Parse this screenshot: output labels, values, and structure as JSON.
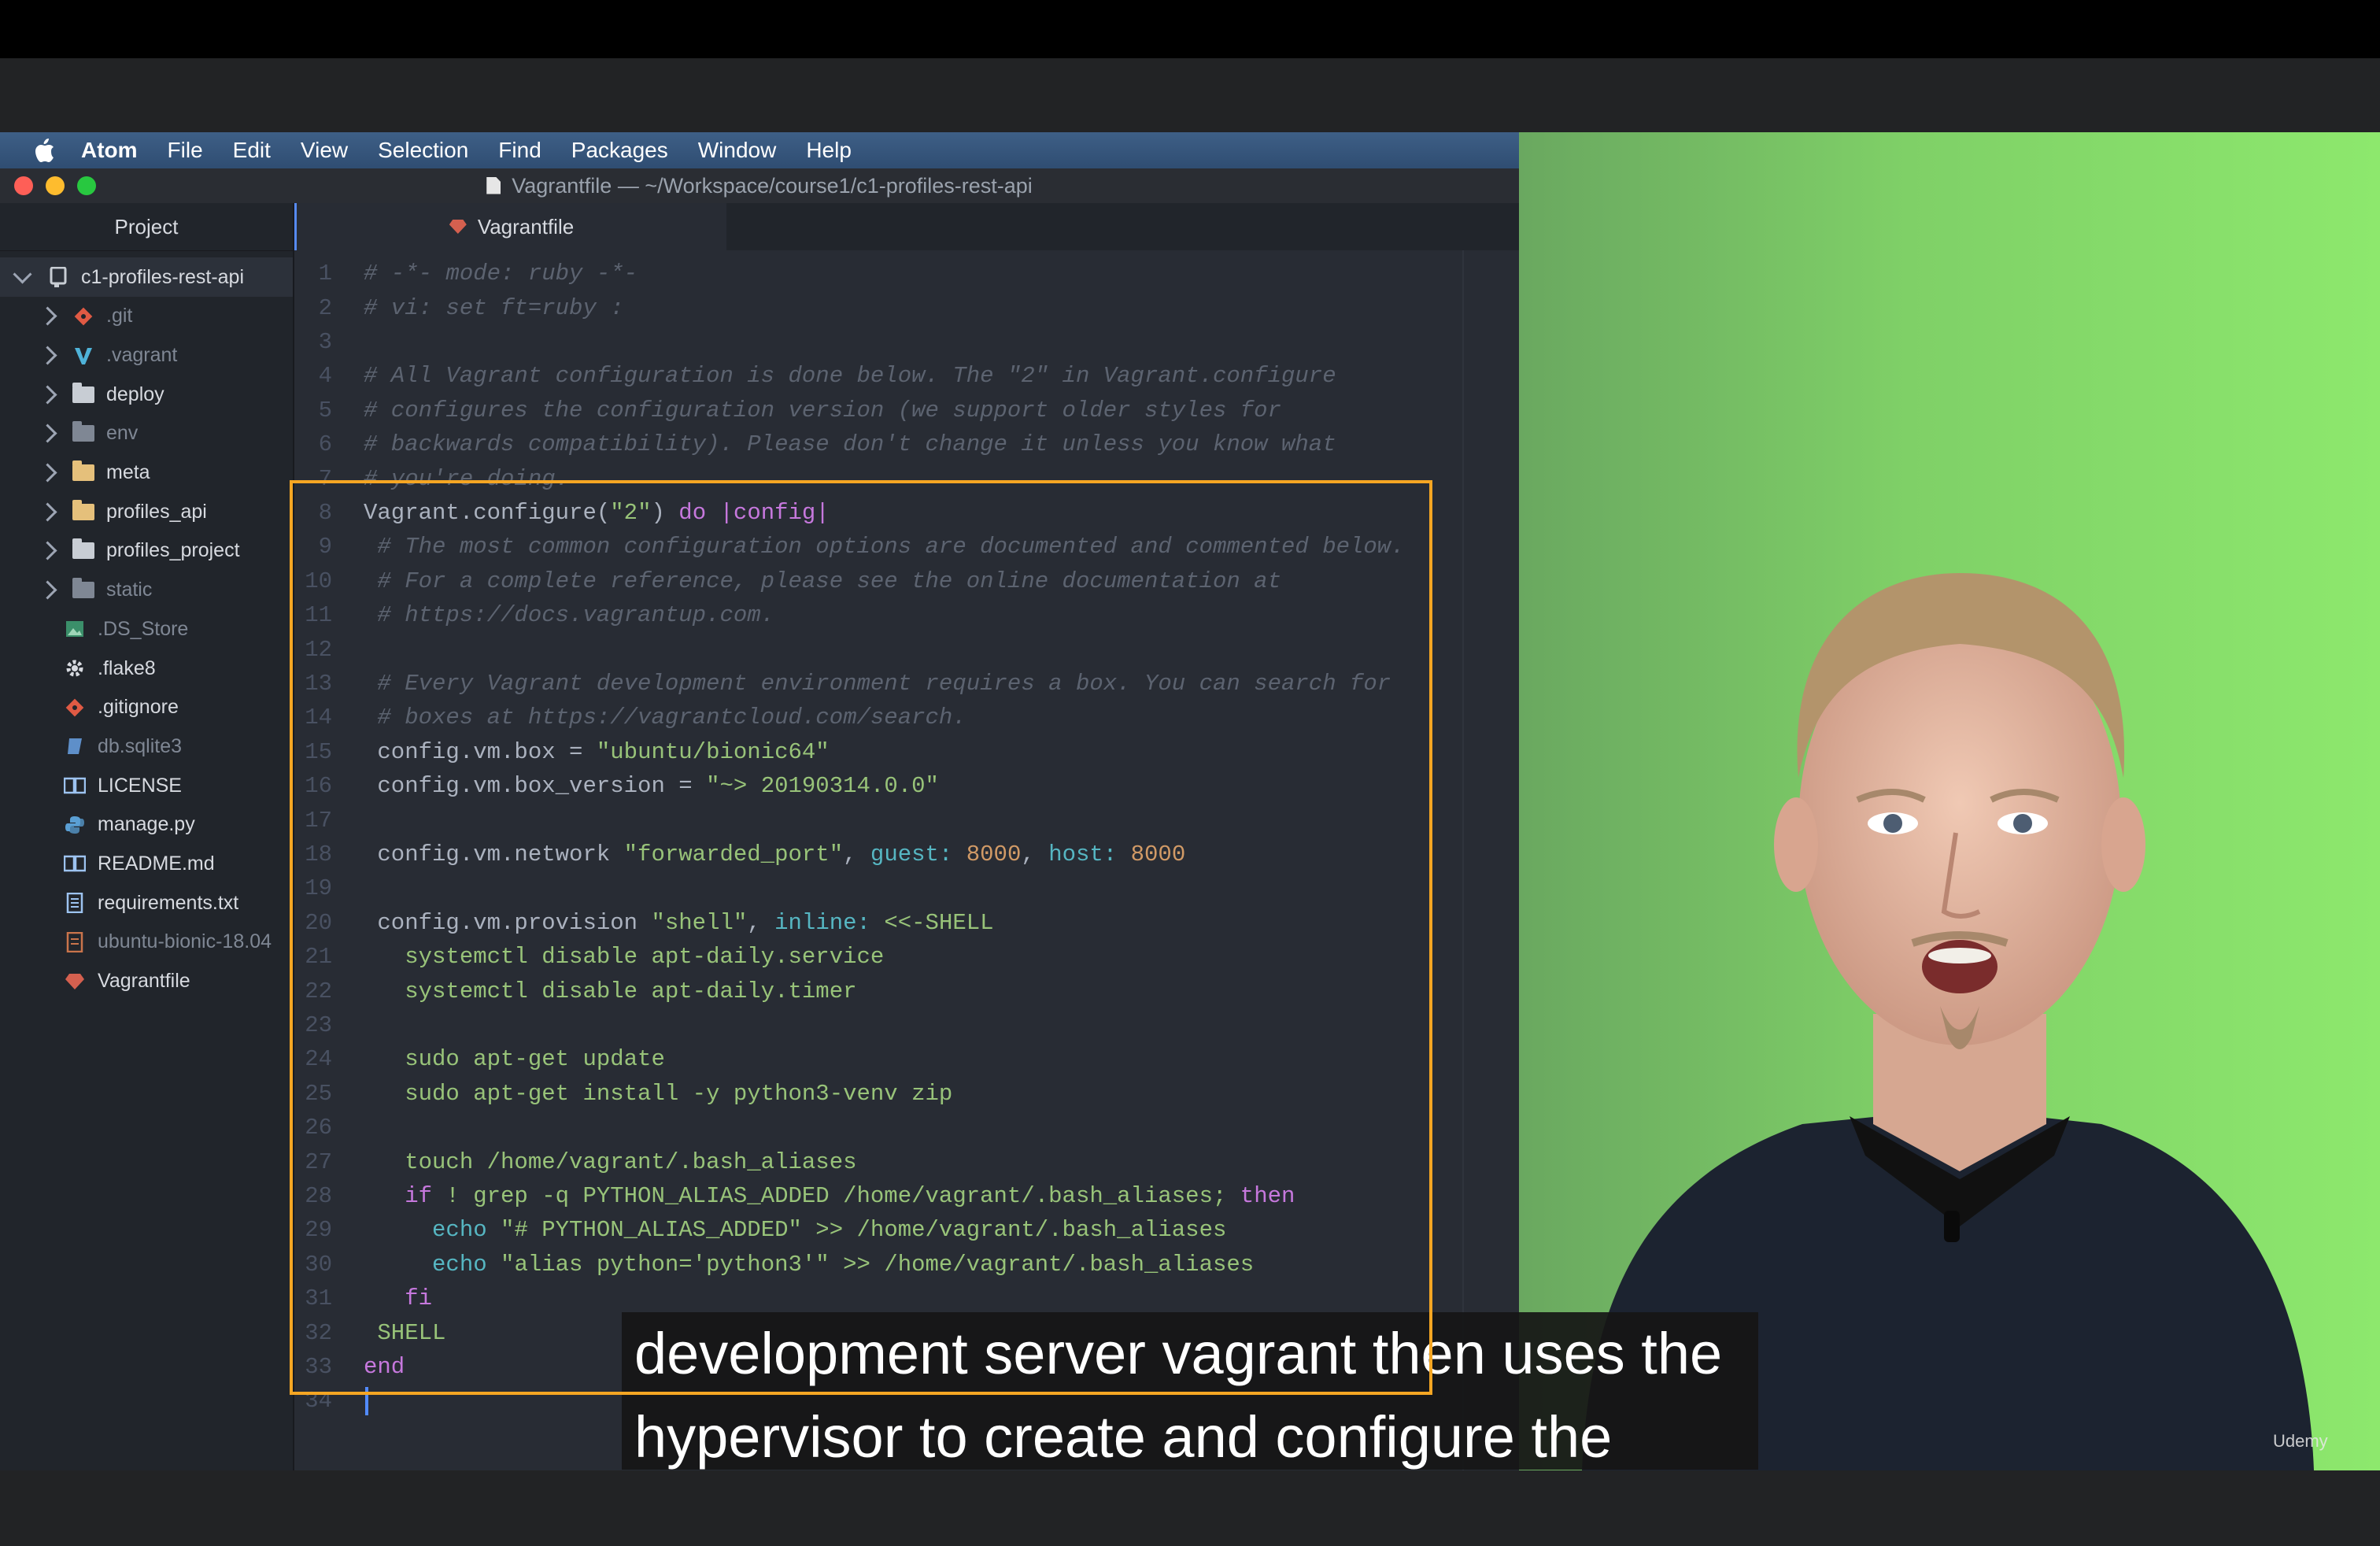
{
  "menubar": {
    "items": [
      "Atom",
      "File",
      "Edit",
      "View",
      "Selection",
      "Find",
      "Packages",
      "Window",
      "Help"
    ]
  },
  "window": {
    "title": "Vagrantfile — ~/Workspace/course1/c1-profiles-rest-api",
    "traffic_colors": [
      "#fe5f57",
      "#febc2e",
      "#28c840"
    ]
  },
  "sidebar": {
    "tab_label": "Project",
    "root": "c1-profiles-rest-api",
    "items": [
      {
        "label": ".git",
        "type": "git",
        "folder": true
      },
      {
        "label": ".vagrant",
        "type": "vagrant",
        "folder": true
      },
      {
        "label": "deploy",
        "type": "folder",
        "folder": true
      },
      {
        "label": "env",
        "type": "folder-dim",
        "folder": true
      },
      {
        "label": "meta",
        "type": "folder-yellow",
        "folder": true
      },
      {
        "label": "profiles_api",
        "type": "folder-yellow",
        "folder": true
      },
      {
        "label": "profiles_project",
        "type": "folder",
        "folder": true
      },
      {
        "label": "static",
        "type": "folder-dim",
        "folder": true
      },
      {
        "label": ".DS_Store",
        "type": "image",
        "folder": false
      },
      {
        "label": ".flake8",
        "type": "gear",
        "folder": false
      },
      {
        "label": ".gitignore",
        "type": "git",
        "folder": false
      },
      {
        "label": "db.sqlite3",
        "type": "db",
        "folder": false
      },
      {
        "label": "LICENSE",
        "type": "book",
        "folder": false
      },
      {
        "label": "manage.py",
        "type": "python",
        "folder": false
      },
      {
        "label": "README.md",
        "type": "book",
        "folder": false
      },
      {
        "label": "requirements.txt",
        "type": "text",
        "folder": false
      },
      {
        "label": "ubuntu-bionic-18.04",
        "type": "text-dim",
        "folder": false
      },
      {
        "label": "Vagrantfile",
        "type": "ruby",
        "folder": false
      }
    ]
  },
  "tab": {
    "label": "Vagrantfile"
  },
  "editor": {
    "lines": [
      [
        [
          "cmt",
          "# -*- mode: ruby -*-"
        ]
      ],
      [
        [
          "cmt",
          "# vi: set ft=ruby :"
        ]
      ],
      [],
      [
        [
          "cmt",
          "# All Vagrant configuration is done below. The \"2\" in Vagrant.configure"
        ]
      ],
      [
        [
          "cmt",
          "# configures the configuration version (we support older styles for"
        ]
      ],
      [
        [
          "cmt",
          "# backwards compatibility). Please don't change it unless you know what"
        ]
      ],
      [
        [
          "cmt",
          "# you're doing."
        ]
      ],
      [
        [
          "code",
          "Vagrant.configure("
        ],
        [
          "str",
          "\"2\""
        ],
        [
          "code",
          ") "
        ],
        [
          "kw",
          "do"
        ],
        [
          "code",
          " "
        ],
        [
          "kw",
          "|config|"
        ]
      ],
      [
        [
          "cmt",
          " # The most common configuration options are documented and commented below."
        ]
      ],
      [
        [
          "cmt",
          " # For a complete reference, please see the online documentation at"
        ]
      ],
      [
        [
          "cmt",
          " # https://docs.vagrantup.com."
        ]
      ],
      [],
      [
        [
          "cmt",
          " # Every Vagrant development environment requires a box. You can search for"
        ]
      ],
      [
        [
          "cmt",
          " # boxes at https://vagrantcloud.com/search."
        ]
      ],
      [
        [
          "code",
          " config.vm.box = "
        ],
        [
          "str",
          "\"ubuntu/bionic64\""
        ]
      ],
      [
        [
          "code",
          " config.vm.box_version = "
        ],
        [
          "str",
          "\"~> 20190314.0.0\""
        ]
      ],
      [],
      [
        [
          "code",
          " config.vm.network "
        ],
        [
          "str",
          "\"forwarded_port\""
        ],
        [
          "code",
          ", "
        ],
        [
          "sym",
          "guest:"
        ],
        [
          "code",
          " "
        ],
        [
          "num",
          "8000"
        ],
        [
          "code",
          ", "
        ],
        [
          "sym",
          "host:"
        ],
        [
          "code",
          " "
        ],
        [
          "num",
          "8000"
        ]
      ],
      [],
      [
        [
          "code",
          " config.vm.provision "
        ],
        [
          "str",
          "\"shell\""
        ],
        [
          "code",
          ", "
        ],
        [
          "sym",
          "inline:"
        ],
        [
          "code",
          " "
        ],
        [
          "str",
          "<<-SHELL"
        ]
      ],
      [
        [
          "str",
          "   systemctl disable apt-daily.service"
        ]
      ],
      [
        [
          "str",
          "   systemctl disable apt-daily.timer"
        ]
      ],
      [],
      [
        [
          "str",
          "   sudo apt-get update"
        ]
      ],
      [
        [
          "str",
          "   sudo apt-get install -y python3-venv zip"
        ]
      ],
      [],
      [
        [
          "str",
          "   touch /home/vagrant/.bash_aliases"
        ]
      ],
      [
        [
          "kw",
          "   if"
        ],
        [
          "str",
          " ! grep -q PYTHON_ALIAS_ADDED /home/vagrant/.bash_aliases; "
        ],
        [
          "kw",
          "then"
        ]
      ],
      [
        [
          "sym",
          "     echo"
        ],
        [
          "str",
          " \"# PYTHON_ALIAS_ADDED\" >> /home/vagrant/.bash_aliases"
        ]
      ],
      [
        [
          "sym",
          "     echo"
        ],
        [
          "str",
          " \"alias python='python3'\" >> /home/vagrant/.bash_aliases"
        ]
      ],
      [
        [
          "kw",
          "   fi"
        ]
      ],
      [
        [
          "str",
          " SHELL"
        ]
      ],
      [
        [
          "kw",
          "end"
        ]
      ],
      []
    ]
  },
  "caption": {
    "line1": "development server vagrant then uses the",
    "line2": "hypervisor to create and configure the"
  },
  "watermark": "Udemy"
}
